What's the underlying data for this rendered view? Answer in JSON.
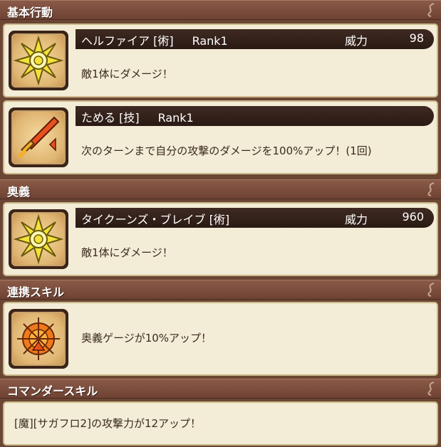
{
  "sections": {
    "basic": {
      "title": "基本行動",
      "skills": [
        {
          "name": "ヘルファイア [術]",
          "rank": "Rank1",
          "power_label": "威力",
          "power_value": "98",
          "description": "敵1体にダメージ！",
          "icon": "star-burst-icon"
        },
        {
          "name": "ためる [技]",
          "rank": "Rank1",
          "description": "次のターンまで自分の攻撃のダメージを100%アップ！(1回)",
          "icon": "sword-powerup-icon"
        }
      ]
    },
    "ougi": {
      "title": "奥義",
      "skill": {
        "name": "タイクーンズ・ブレイブ [術]",
        "power_label": "威力",
        "power_value": "960",
        "description": "敵1体にダメージ！",
        "icon": "star-burst-icon"
      }
    },
    "renkei": {
      "title": "連携スキル",
      "skill": {
        "description": "奥義ゲージが10%アップ！",
        "icon": "compass-powerup-icon"
      }
    },
    "commander": {
      "title": "コマンダースキル",
      "description": "[魔][サガフロ2]の攻撃力が12アップ！"
    }
  },
  "colors": {
    "header_bg": "#7a4c3c",
    "card_bg": "#f3ecd6",
    "name_bar_bg": "#2e1e17",
    "text_dark": "#3a2a1e"
  }
}
